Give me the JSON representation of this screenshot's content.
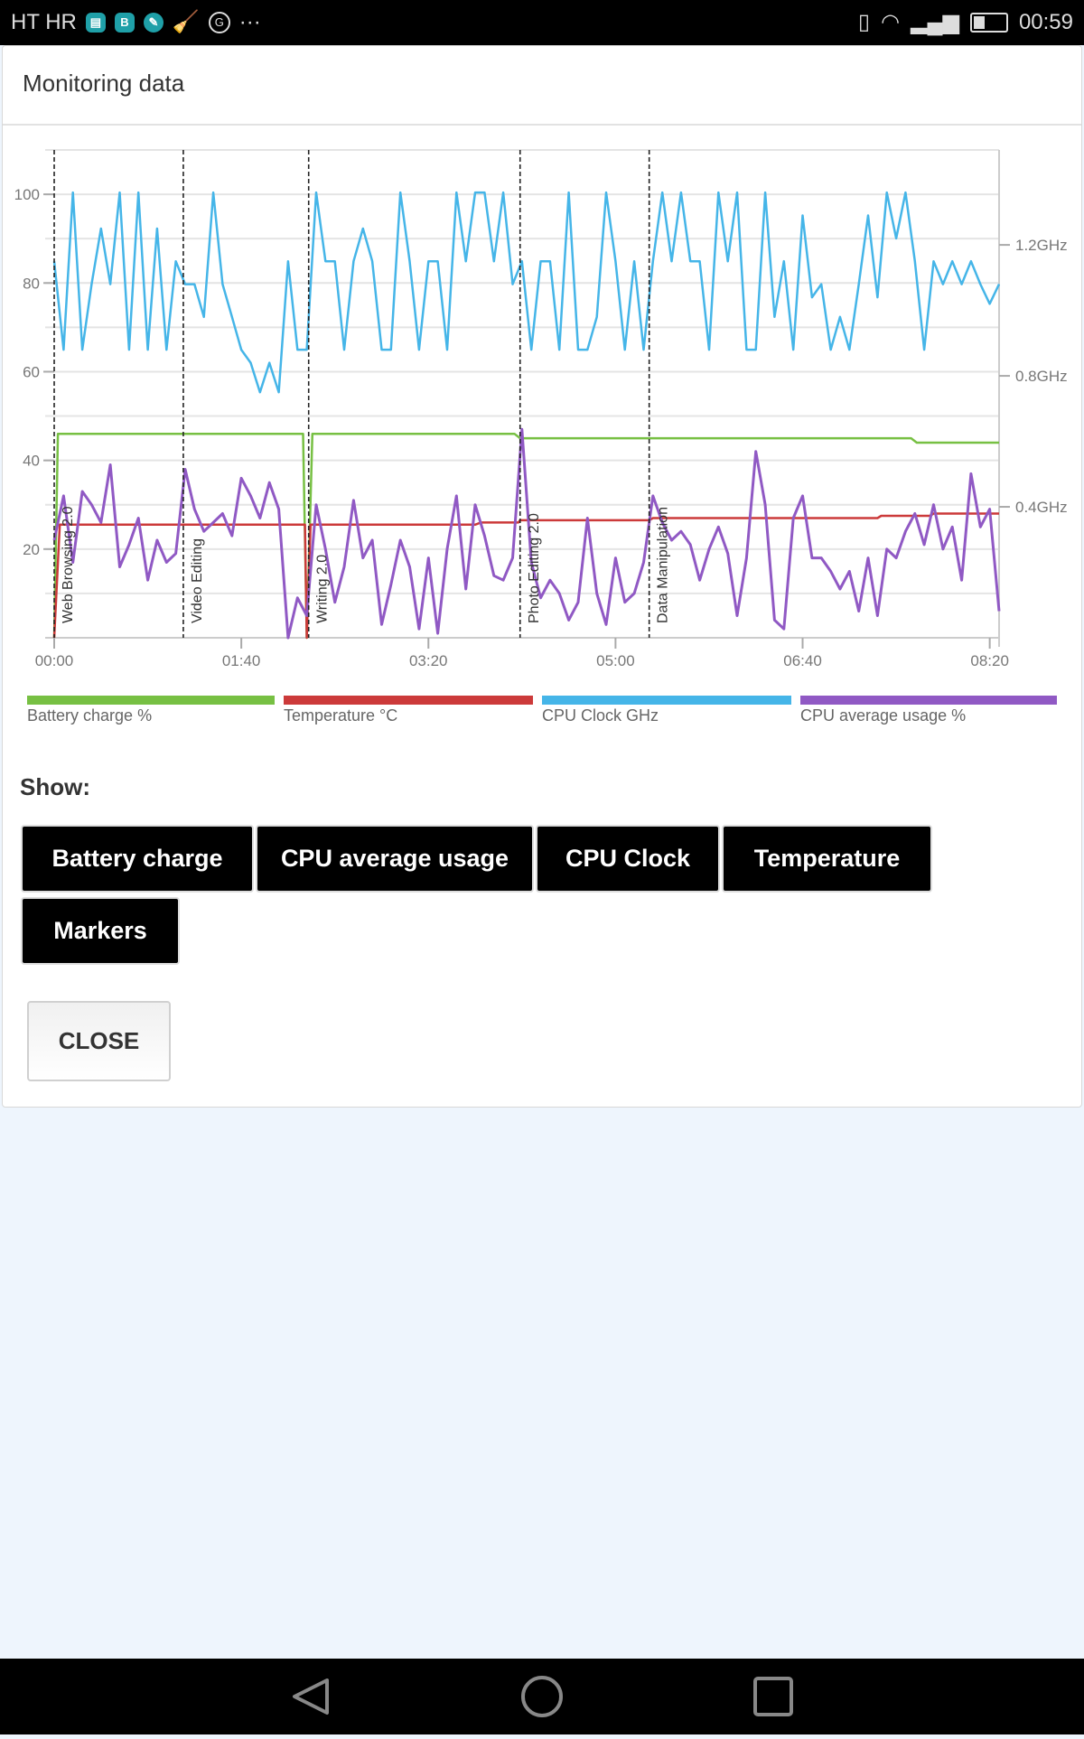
{
  "status_bar": {
    "carrier": "HT HR",
    "time": "00:59",
    "icons": [
      "sim-app-icon",
      "b-app-icon",
      "edit-app-icon",
      "broom-icon",
      "g-icon",
      "more-icon",
      "vibrate-icon",
      "wifi-icon",
      "signal-icon",
      "battery-icon"
    ],
    "more": "···"
  },
  "header": {
    "title": "Monitoring data"
  },
  "chart_data": {
    "type": "line",
    "x_unit": "mm:ss",
    "xlim": [
      0,
      505
    ],
    "x_ticks": [
      "00:00",
      "01:40",
      "03:20",
      "05:00",
      "06:40",
      "08:20"
    ],
    "x_tick_values": [
      0,
      100,
      200,
      300,
      400,
      500
    ],
    "ylim": [
      0,
      110
    ],
    "y_ticks": [
      20,
      40,
      60,
      80,
      100
    ],
    "y2lim": [
      0,
      1.49
    ],
    "y2_ticks": [
      "0.4GHz",
      "0.8GHz",
      "1.2GHz"
    ],
    "y2_tick_values": [
      0.4,
      0.8,
      1.2
    ],
    "grid": true,
    "legend_position": "bottom",
    "markers": [
      {
        "label": "Web Browsing 2.0",
        "t": 0
      },
      {
        "label": "Video Editing",
        "t": 69
      },
      {
        "label": "Writing 2.0",
        "t": 136
      },
      {
        "label": "Photo Editing 2.0",
        "t": 249
      },
      {
        "label": "Data Manipulation",
        "t": 318
      }
    ],
    "series": [
      {
        "name": "Battery charge %",
        "color": "#77c043",
        "axis": "left",
        "step": 5,
        "points": [
          [
            0,
            0
          ],
          [
            2,
            46
          ],
          [
            133,
            46
          ],
          [
            135,
            0
          ],
          [
            138,
            46
          ],
          [
            246,
            46
          ],
          [
            249,
            45
          ],
          [
            458,
            45
          ],
          [
            461,
            44
          ],
          [
            505,
            44
          ]
        ]
      },
      {
        "name": "Temperature °C",
        "color": "#cc3a3a",
        "axis": "left",
        "points": [
          [
            0,
            0
          ],
          [
            3,
            25.5
          ],
          [
            134,
            25.5
          ],
          [
            135,
            0
          ],
          [
            137,
            25.5
          ],
          [
            225,
            25.5
          ],
          [
            228,
            26
          ],
          [
            248,
            26
          ],
          [
            249,
            26.5
          ],
          [
            318,
            26.5
          ],
          [
            320,
            27
          ],
          [
            440,
            27
          ],
          [
            442,
            27.5
          ],
          [
            468,
            27.5
          ],
          [
            470,
            28
          ],
          [
            505,
            28
          ]
        ]
      },
      {
        "name": "CPU Clock GHz",
        "color": "#45b5e8",
        "axis": "right",
        "step": 5,
        "values": [
          1.15,
          0.88,
          1.36,
          0.88,
          1.08,
          1.25,
          1.08,
          1.36,
          0.88,
          1.36,
          0.88,
          1.25,
          0.88,
          1.15,
          1.08,
          1.08,
          0.98,
          1.36,
          1.08,
          0.98,
          0.88,
          0.84,
          0.75,
          0.84,
          0.75,
          1.15,
          0.88,
          0.88,
          1.36,
          1.15,
          1.15,
          0.88,
          1.15,
          1.25,
          1.15,
          0.88,
          0.88,
          1.36,
          1.15,
          0.88,
          1.15,
          1.15,
          0.88,
          1.36,
          1.15,
          1.36,
          1.36,
          1.15,
          1.36,
          1.08,
          1.15,
          0.88,
          1.15,
          1.15,
          0.88,
          1.36,
          0.88,
          0.88,
          0.98,
          1.36,
          1.15,
          0.88,
          1.15,
          0.88,
          1.15,
          1.36,
          1.15,
          1.36,
          1.15,
          1.15,
          0.88,
          1.36,
          1.15,
          1.36,
          0.88,
          0.88,
          1.36,
          0.98,
          1.15,
          0.88,
          1.29,
          1.04,
          1.08,
          0.88,
          0.98,
          0.88,
          1.08,
          1.29,
          1.04,
          1.36,
          1.22,
          1.36,
          1.15,
          0.88,
          1.15,
          1.08,
          1.15,
          1.08,
          1.15,
          1.08,
          1.02,
          1.08
        ]
      },
      {
        "name": "CPU average usage %",
        "color": "#9059c4",
        "axis": "left",
        "step": 5,
        "values": [
          22,
          32,
          17,
          33,
          30,
          26,
          39,
          16,
          21,
          27,
          13,
          22,
          17,
          19,
          38,
          29,
          24,
          26,
          28,
          23,
          36,
          32,
          27,
          35,
          29,
          0,
          9,
          5,
          30,
          20,
          8,
          16,
          31,
          18,
          22,
          3,
          12,
          22,
          16,
          2,
          18,
          1,
          20,
          32,
          11,
          30,
          23,
          14,
          13,
          18,
          47,
          17,
          9,
          13,
          10,
          4,
          8,
          27,
          10,
          3,
          18,
          8,
          10,
          17,
          32,
          26,
          22,
          24,
          21,
          13,
          20,
          25,
          19,
          5,
          18,
          42,
          30,
          4,
          2,
          27,
          32,
          18,
          18,
          15,
          11,
          15,
          6,
          18,
          5,
          20,
          18,
          24,
          28,
          21,
          30,
          20,
          25,
          13,
          37,
          25,
          29,
          6
        ]
      }
    ]
  },
  "show": {
    "label": "Show:",
    "buttons": [
      "Battery charge",
      "CPU average usage",
      "CPU Clock",
      "Temperature",
      "Markers"
    ]
  },
  "close_label": "CLOSE"
}
